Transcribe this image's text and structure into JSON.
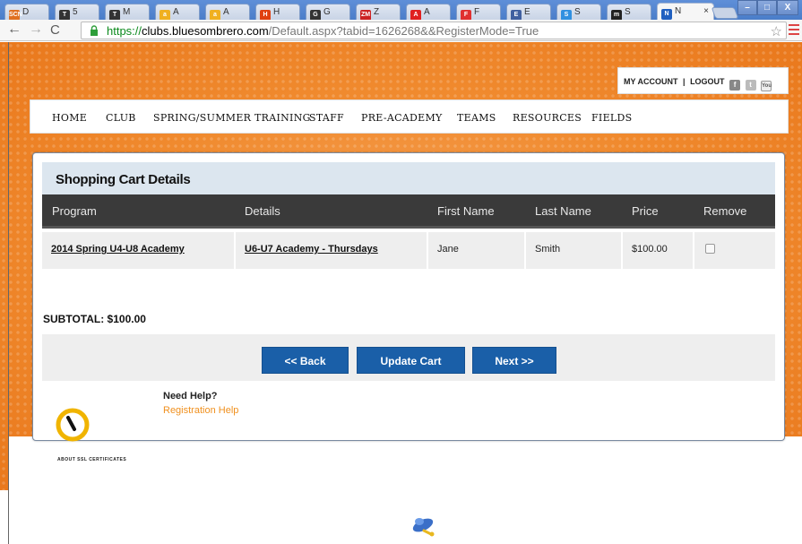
{
  "browser": {
    "tabs": [
      {
        "label": "D",
        "favicon": "SCN",
        "favicon_color": "#e07020"
      },
      {
        "label": "5",
        "favicon": "T",
        "favicon_color": "#333333"
      },
      {
        "label": "M",
        "favicon": "T",
        "favicon_color": "#333333"
      },
      {
        "label": "A",
        "favicon": "a",
        "favicon_color": "#f0b020"
      },
      {
        "label": "A",
        "favicon": "a",
        "favicon_color": "#f0b020"
      },
      {
        "label": "H",
        "favicon": "H",
        "favicon_color": "#e04010"
      },
      {
        "label": "G",
        "favicon": "G",
        "favicon_color": "#333333"
      },
      {
        "label": "Z",
        "favicon": "ZM",
        "favicon_color": "#cc2222"
      },
      {
        "label": "A",
        "favicon": "A",
        "favicon_color": "#e02020"
      },
      {
        "label": "F",
        "favicon": "F",
        "favicon_color": "#e03030"
      },
      {
        "label": "E",
        "favicon": "E",
        "favicon_color": "#4060a0"
      },
      {
        "label": "S",
        "favicon": "S",
        "favicon_color": "#3090e0"
      },
      {
        "label": "S",
        "favicon": "m",
        "favicon_color": "#222222"
      },
      {
        "label": "N",
        "favicon": "N",
        "favicon_color": "#2060c0",
        "active": true
      }
    ],
    "url_scheme": "https://",
    "url_host": "clubs.bluesombrero.com",
    "url_path": "/Default.aspx?tabid=1626268&&RegisterMode=True",
    "star_icon": "star-icon",
    "win_minimize": "–",
    "win_maximize": "□",
    "win_close": "X",
    "tab_close": "×"
  },
  "account": {
    "my_account": "MY ACCOUNT",
    "separator": "|",
    "logout": "LOGOUT",
    "facebook": "f",
    "twitter": "t",
    "youtube": "You"
  },
  "nav": {
    "items": [
      "HOME",
      "CLUB",
      "SPRING/SUMMER TRAINING",
      "STAFF",
      "PRE-ACADEMY",
      "TEAMS",
      "RESOURCES",
      "FIELDS"
    ]
  },
  "cart": {
    "title": "Shopping Cart Details",
    "headers": [
      "Program",
      "Details",
      "First Name",
      "Last Name",
      "Price",
      "Remove"
    ],
    "rows": [
      {
        "program": "2014 Spring U4-U8 Academy",
        "details": "U6-U7 Academy - Thursdays",
        "first_name": "Jane",
        "last_name": "Smith",
        "price": "$100.00",
        "remove": false
      }
    ],
    "subtotal": "SUBTOTAL: $100.00",
    "buttons": {
      "back": "<< Back",
      "update": "Update Cart",
      "next": "Next >>"
    }
  },
  "help": {
    "title": "Need Help?",
    "link": "Registration Help",
    "ssl_text": "ABOUT SSL CERTIFICATES"
  },
  "colors": {
    "accent_blue": "#1a5fa8",
    "orange_bg": "#f08a2e",
    "header_dark": "#3a3a3a",
    "help_link": "#f0901e"
  }
}
